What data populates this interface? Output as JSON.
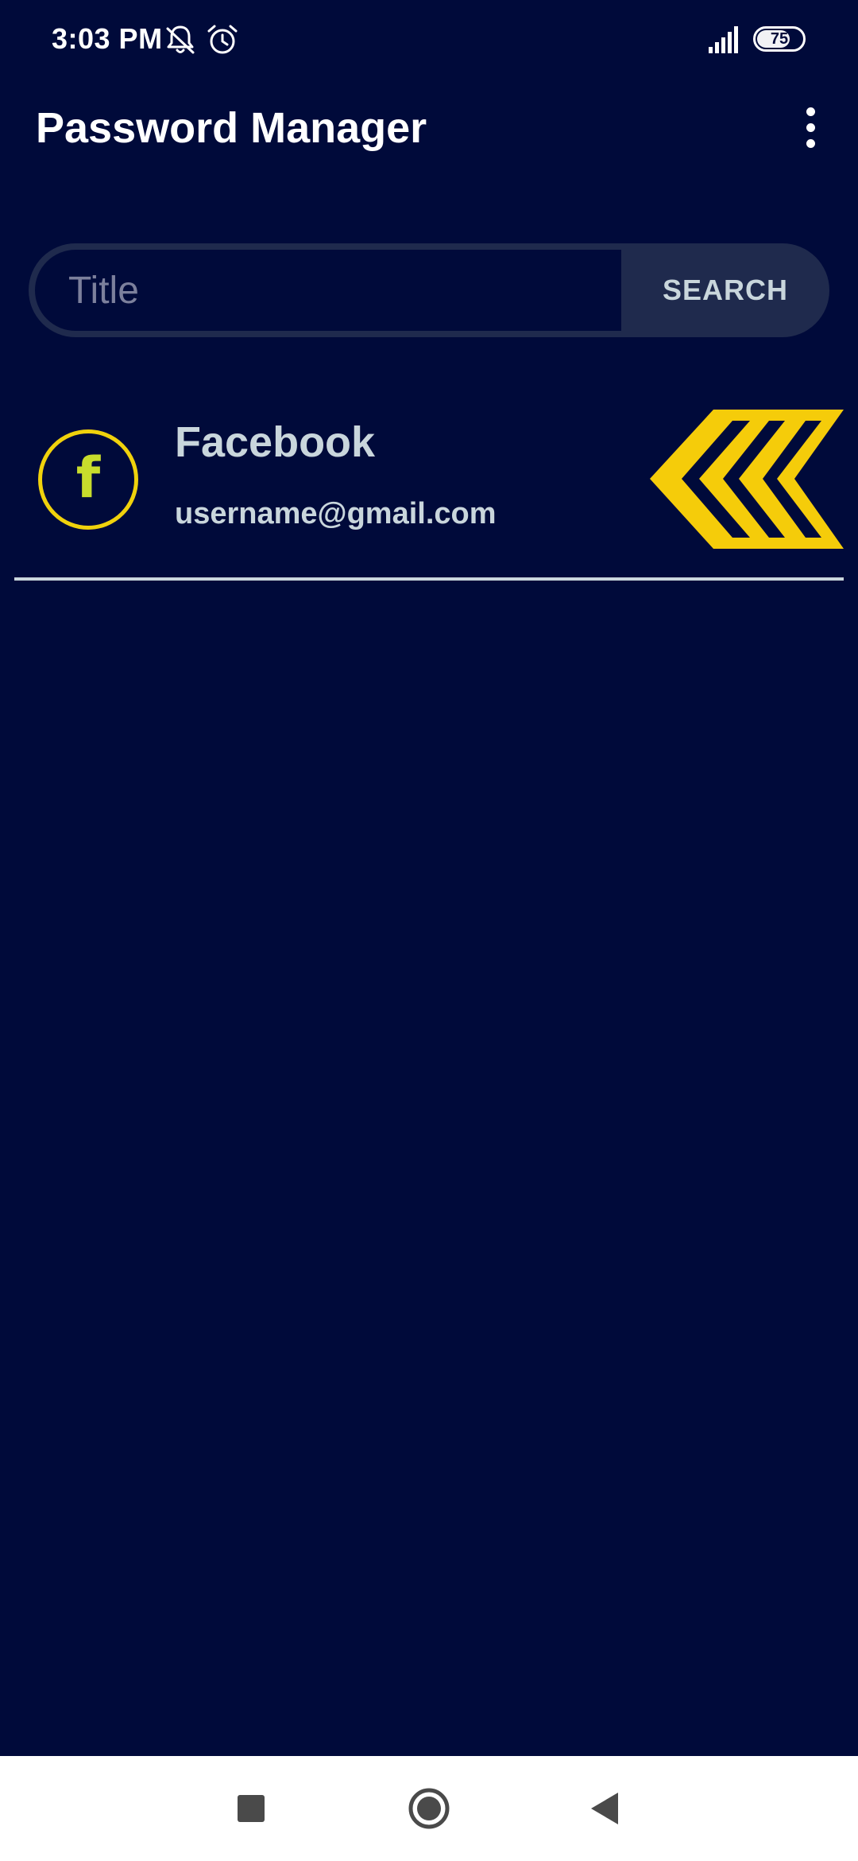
{
  "status_bar": {
    "time": "3:03 PM",
    "battery_level": "75",
    "icons": [
      "notifications-off-icon",
      "alarm-icon",
      "signal-icon",
      "battery-icon"
    ]
  },
  "app_bar": {
    "title": "Password Manager",
    "menu_icon": "more-vertical-icon"
  },
  "search": {
    "placeholder": "Title",
    "value": "",
    "button_label": "SEARCH"
  },
  "credentials": [
    {
      "icon": "facebook-icon",
      "icon_glyph": "f",
      "title": "Facebook",
      "username": "username@gmail.com",
      "action_icon": "chevrons-left-icon"
    }
  ],
  "colors": {
    "background": "#000a3a",
    "accent": "#f0d20c",
    "text_secondary": "#c9d6dc",
    "search_button_bg": "#1f2a4d"
  },
  "nav_bar": {
    "buttons": [
      "recents-icon",
      "home-icon",
      "back-icon"
    ]
  }
}
